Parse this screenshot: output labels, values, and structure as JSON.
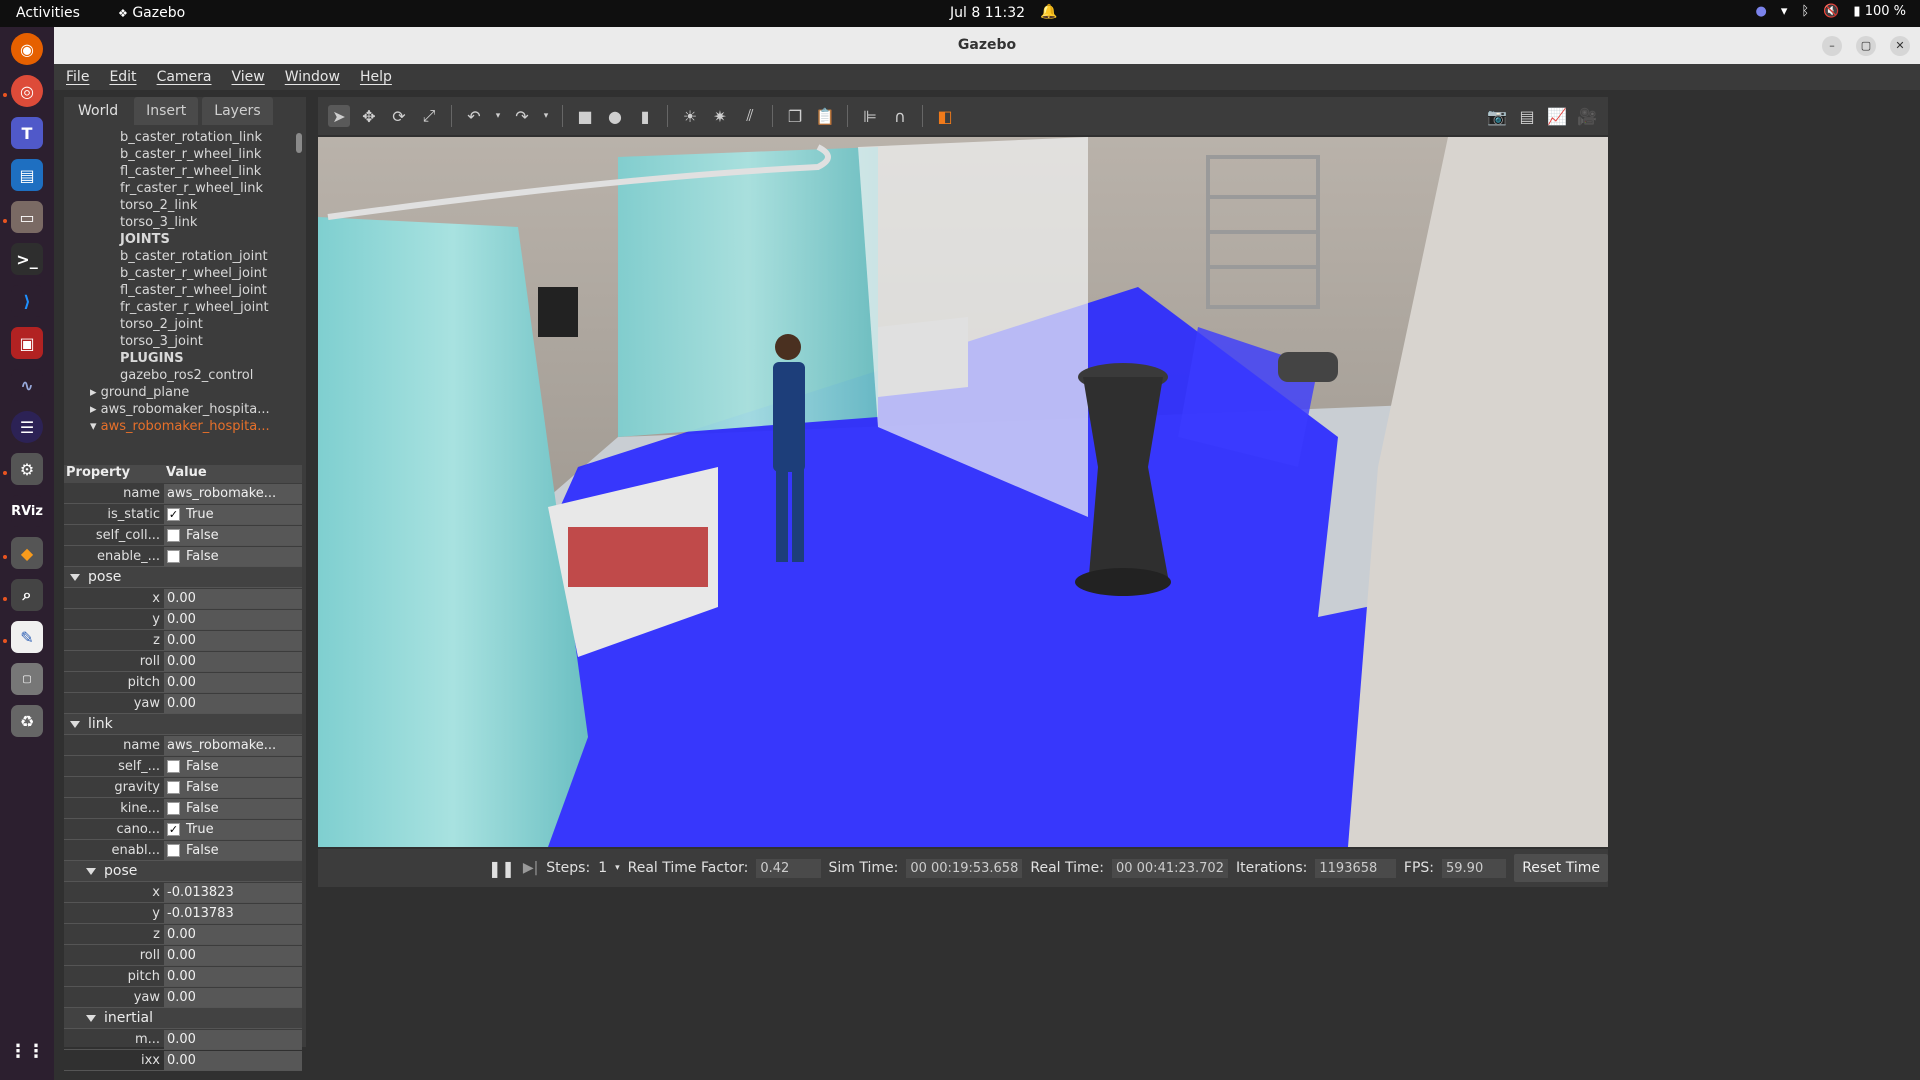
{
  "topbar": {
    "activities": "Activities",
    "app_name": "Gazebo",
    "clock": "Jul 8  11:32",
    "battery": "100 %"
  },
  "window": {
    "title": "Gazebo"
  },
  "menu": [
    "File",
    "Edit",
    "Camera",
    "View",
    "Window",
    "Help"
  ],
  "left_tabs": [
    "World",
    "Insert",
    "Layers"
  ],
  "tree": [
    {
      "label": "b_caster_rotation_link",
      "kind": "item"
    },
    {
      "label": "b_caster_r_wheel_link",
      "kind": "item"
    },
    {
      "label": "fl_caster_r_wheel_link",
      "kind": "item"
    },
    {
      "label": "fr_caster_r_wheel_link",
      "kind": "item"
    },
    {
      "label": "torso_2_link",
      "kind": "item"
    },
    {
      "label": "torso_3_link",
      "kind": "item"
    },
    {
      "label": "JOINTS",
      "kind": "hdr"
    },
    {
      "label": "b_caster_rotation_joint",
      "kind": "item"
    },
    {
      "label": "b_caster_r_wheel_joint",
      "kind": "item"
    },
    {
      "label": "fl_caster_r_wheel_joint",
      "kind": "item"
    },
    {
      "label": "fr_caster_r_wheel_joint",
      "kind": "item"
    },
    {
      "label": "torso_2_joint",
      "kind": "item"
    },
    {
      "label": "torso_3_joint",
      "kind": "item"
    },
    {
      "label": "PLUGINS",
      "kind": "hdr"
    },
    {
      "label": "gazebo_ros2_control",
      "kind": "item"
    },
    {
      "label": "ground_plane",
      "kind": "model"
    },
    {
      "label": "aws_robomaker_hospita...",
      "kind": "model"
    },
    {
      "label": "aws_robomaker_hospita...",
      "kind": "sel"
    }
  ],
  "props": {
    "col_property": "Property",
    "col_value": "Value",
    "rows": [
      {
        "type": "row",
        "name": "name",
        "value": "aws_robomake...",
        "indent": 0
      },
      {
        "type": "check",
        "name": "is_static",
        "value": "True",
        "checked": true,
        "indent": 0
      },
      {
        "type": "check",
        "name": "self_coll...",
        "value": "False",
        "checked": false,
        "indent": 0
      },
      {
        "type": "check",
        "name": "enable_...",
        "value": "False",
        "checked": false,
        "indent": 0
      },
      {
        "type": "section",
        "name": "pose",
        "indent": 0
      },
      {
        "type": "row",
        "name": "x",
        "value": "0.00",
        "indent": 0
      },
      {
        "type": "row",
        "name": "y",
        "value": "0.00",
        "indent": 0
      },
      {
        "type": "row",
        "name": "z",
        "value": "0.00",
        "indent": 0
      },
      {
        "type": "row",
        "name": "roll",
        "value": "0.00",
        "indent": 0
      },
      {
        "type": "row",
        "name": "pitch",
        "value": "0.00",
        "indent": 0
      },
      {
        "type": "row",
        "name": "yaw",
        "value": "0.00",
        "indent": 0
      },
      {
        "type": "section",
        "name": "link",
        "indent": 0
      },
      {
        "type": "row",
        "name": "name",
        "value": "aws_robomake...",
        "indent": 1
      },
      {
        "type": "check",
        "name": "self_...",
        "value": "False",
        "checked": false,
        "indent": 1
      },
      {
        "type": "check",
        "name": "gravity",
        "value": "False",
        "checked": false,
        "indent": 1
      },
      {
        "type": "check",
        "name": "kine...",
        "value": "False",
        "checked": false,
        "indent": 1
      },
      {
        "type": "check",
        "name": "cano...",
        "value": "True",
        "checked": true,
        "indent": 1
      },
      {
        "type": "check",
        "name": "enabl...",
        "value": "False",
        "checked": false,
        "indent": 1
      },
      {
        "type": "section",
        "name": "pose",
        "indent": 1
      },
      {
        "type": "row",
        "name": "x",
        "value": "-0.013823",
        "indent": 2
      },
      {
        "type": "row",
        "name": "y",
        "value": "-0.013783",
        "indent": 2
      },
      {
        "type": "row",
        "name": "z",
        "value": "0.00",
        "indent": 2
      },
      {
        "type": "row",
        "name": "roll",
        "value": "0.00",
        "indent": 2
      },
      {
        "type": "row",
        "name": "pitch",
        "value": "0.00",
        "indent": 2
      },
      {
        "type": "row",
        "name": "yaw",
        "value": "0.00",
        "indent": 2
      },
      {
        "type": "section",
        "name": "inertial",
        "indent": 1
      },
      {
        "type": "row",
        "name": "m...",
        "value": "0.00",
        "indent": 2
      },
      {
        "type": "row",
        "name": "ixx",
        "value": "0.00",
        "indent": 2
      }
    ]
  },
  "bottom": {
    "steps_label": "Steps:",
    "steps_value": "1",
    "rtf_label": "Real Time Factor:",
    "rtf_value": "0.42",
    "sim_label": "Sim Time:",
    "sim_value": "00 00:19:53.658",
    "real_label": "Real Time:",
    "real_value": "00 00:41:23.702",
    "iter_label": "Iterations:",
    "iter_value": "1193658",
    "fps_label": "FPS:",
    "fps_value": "59.90",
    "reset_label": "Reset Time"
  },
  "dock_apps": [
    "Firefox",
    "Chrome",
    "Teams",
    "Writer",
    "Files",
    "Terminal",
    "VS Code",
    "App",
    "Monitor",
    "Eclipse",
    "Settings",
    "RViz",
    "Ubuntu Store",
    "Search",
    "Text Editor",
    "SSD",
    "Recycle",
    "Show Apps"
  ],
  "dock_labels": {
    "rviz": "RViz"
  },
  "colors": {
    "accent_orange": "#e8702a",
    "laser_blue": "#2a2aff",
    "panel_bg": "#3c3c3c"
  }
}
